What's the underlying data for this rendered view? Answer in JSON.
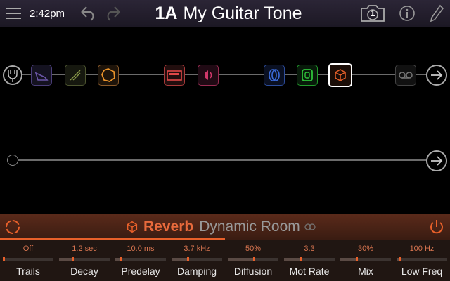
{
  "topbar": {
    "time": "2:42pm",
    "preset_number": "1A",
    "preset_name": "My Guitar Tone",
    "snapshot_number": "1",
    "icons": [
      "menu-icon",
      "undo-icon",
      "redo-icon",
      "snapshot-camera-icon",
      "info-icon",
      "tuner-icon"
    ]
  },
  "signal_flow": {
    "path1_blocks": [
      {
        "name": "input-block",
        "icon": "input-icon"
      },
      {
        "name": "wah-block",
        "icon": "wah-pedal-icon",
        "color": "#6b56a8"
      },
      {
        "name": "drive-block",
        "icon": "drive-icon",
        "color": "#8a9a4a"
      },
      {
        "name": "dynamics-block",
        "icon": "dynamics-icon",
        "color": "#e8922a"
      },
      {
        "name": "amp-block",
        "icon": "amp-icon",
        "color": "#e04848"
      },
      {
        "name": "cab-block",
        "icon": "speaker-icon",
        "color": "#d0386a"
      },
      {
        "name": "modulation-block",
        "icon": "modulation-icon",
        "color": "#3a6ad8"
      },
      {
        "name": "delay-block",
        "icon": "delay-icon",
        "color": "#2ec43a"
      },
      {
        "name": "reverb-block",
        "icon": "reverb-icon",
        "color": "#e8602a"
      },
      {
        "name": "looper-block",
        "icon": "looper-icon",
        "color": "#888888"
      },
      {
        "name": "output-block",
        "icon": "output-arrow-icon"
      }
    ],
    "path2_blocks": [
      {
        "name": "input-point",
        "icon": "input-point-icon"
      },
      {
        "name": "output-block",
        "icon": "output-arrow-icon"
      }
    ]
  },
  "editor": {
    "category": "Reverb",
    "model": "Dynamic Room",
    "accent": "#e8602a",
    "params": [
      {
        "name": "Trails",
        "value": "Off",
        "level": 0.0
      },
      {
        "name": "Decay",
        "value": "1.2 sec",
        "level": 0.25
      },
      {
        "name": "Predelay",
        "value": "10.0 ms",
        "level": 0.1
      },
      {
        "name": "Damping",
        "value": "3.7 kHz",
        "level": 0.3
      },
      {
        "name": "Diffusion",
        "value": "50%",
        "level": 0.5
      },
      {
        "name": "Mot Rate",
        "value": "3.3",
        "level": 0.3
      },
      {
        "name": "Mix",
        "value": "30%",
        "level": 0.3
      },
      {
        "name": "Low Freq",
        "value": "100 Hz",
        "level": 0.05
      }
    ]
  }
}
